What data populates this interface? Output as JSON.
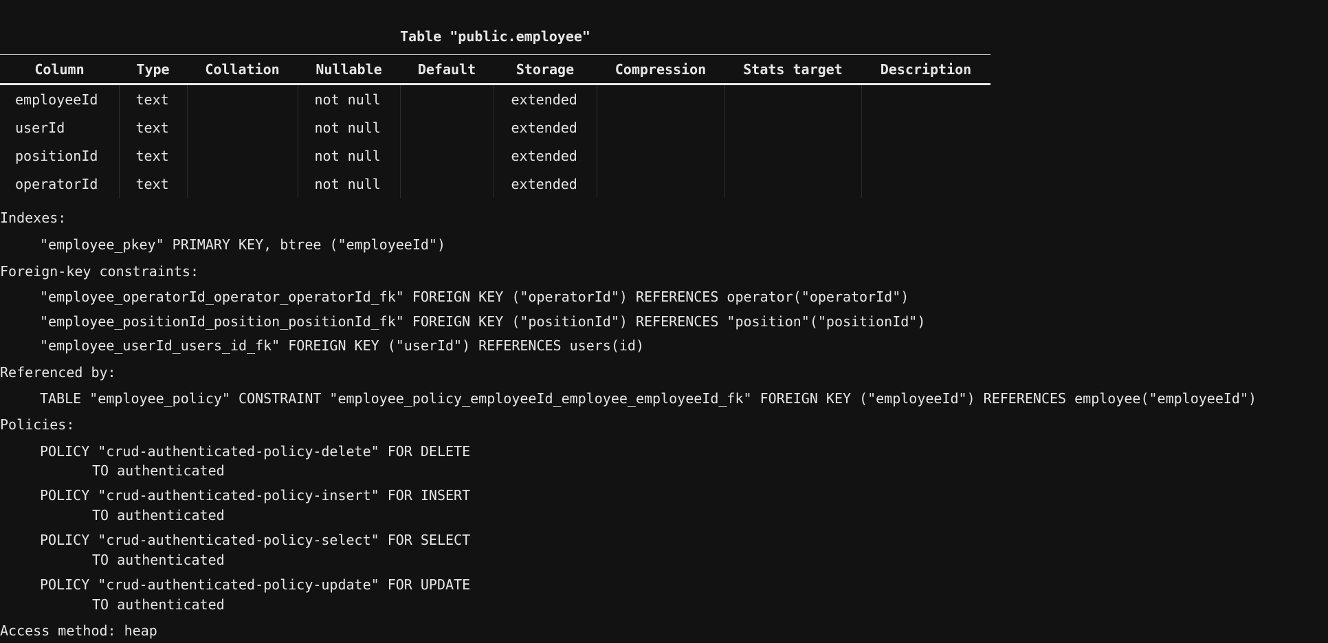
{
  "table": {
    "title": "Table \"public.employee\"",
    "columns": [
      "Column",
      "Type",
      "Collation",
      "Nullable",
      "Default",
      "Storage",
      "Compression",
      "Stats target",
      "Description"
    ],
    "rows": [
      [
        "employeeId",
        "text",
        "",
        "not null",
        "",
        "extended",
        "",
        "",
        ""
      ],
      [
        "userId",
        "text",
        "",
        "not null",
        "",
        "extended",
        "",
        "",
        ""
      ],
      [
        "positionId",
        "text",
        "",
        "not null",
        "",
        "extended",
        "",
        "",
        ""
      ],
      [
        "operatorId",
        "text",
        "",
        "not null",
        "",
        "extended",
        "",
        "",
        ""
      ]
    ]
  },
  "indexes": {
    "header": "Indexes:",
    "items": [
      "\"employee_pkey\" PRIMARY KEY, btree (\"employeeId\")"
    ]
  },
  "foreign_keys": {
    "header": "Foreign-key constraints:",
    "items": [
      "\"employee_operatorId_operator_operatorId_fk\" FOREIGN KEY (\"operatorId\") REFERENCES operator(\"operatorId\")",
      "\"employee_positionId_position_positionId_fk\" FOREIGN KEY (\"positionId\") REFERENCES \"position\"(\"positionId\")",
      "\"employee_userId_users_id_fk\" FOREIGN KEY (\"userId\") REFERENCES users(id)"
    ]
  },
  "referenced_by": {
    "header": "Referenced by:",
    "items": [
      "TABLE \"employee_policy\" CONSTRAINT \"employee_policy_employeeId_employee_employeeId_fk\" FOREIGN KEY (\"employeeId\") REFERENCES employee(\"employeeId\")"
    ]
  },
  "policies": {
    "header": "Policies:",
    "items": [
      {
        "policy": "POLICY \"crud-authenticated-policy-delete\" FOR DELETE",
        "to": "TO authenticated"
      },
      {
        "policy": "POLICY \"crud-authenticated-policy-insert\" FOR INSERT",
        "to": "TO authenticated"
      },
      {
        "policy": "POLICY \"crud-authenticated-policy-select\" FOR SELECT",
        "to": "TO authenticated"
      },
      {
        "policy": "POLICY \"crud-authenticated-policy-update\" FOR UPDATE",
        "to": "TO authenticated"
      }
    ]
  },
  "access_method": "Access method: heap"
}
